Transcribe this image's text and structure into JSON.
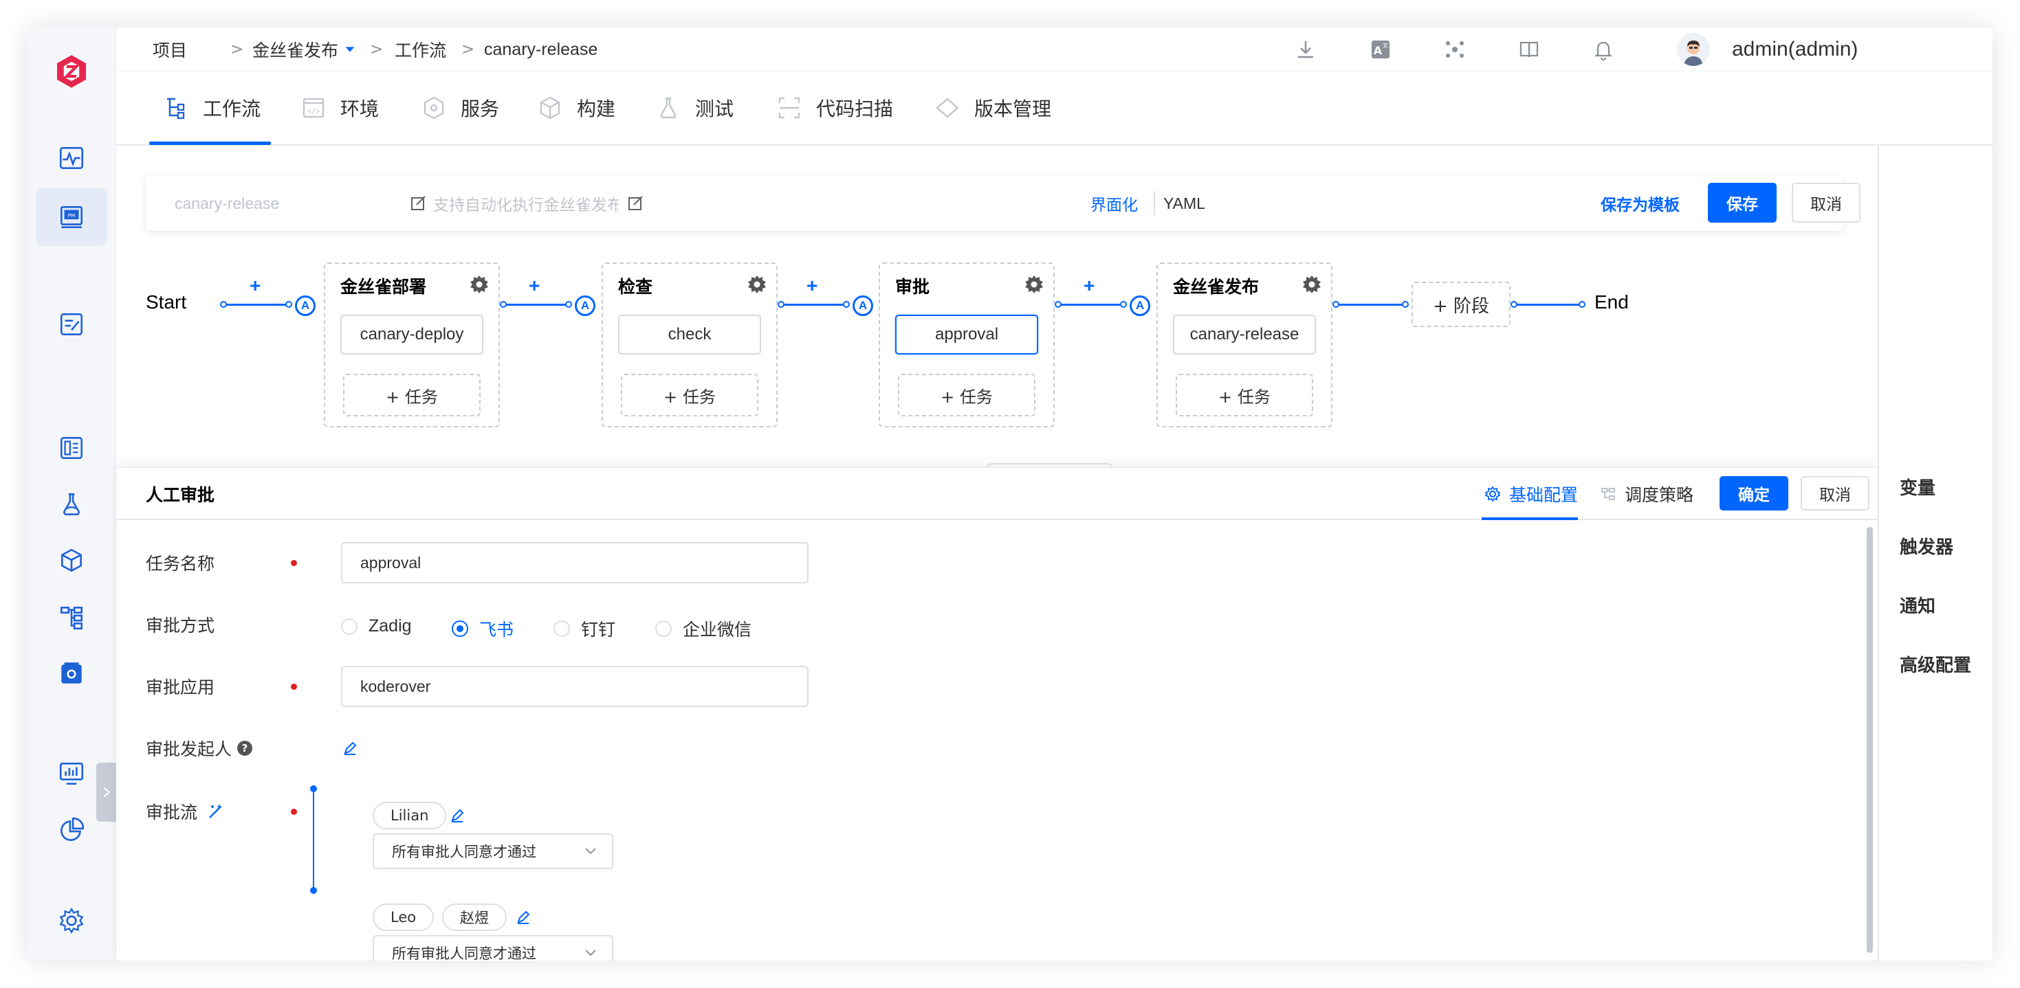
{
  "breadcrumb": {
    "items": [
      "项目",
      "金丝雀发布",
      "工作流",
      "canary-release"
    ],
    "separator": ">"
  },
  "user": {
    "name": "admin(admin)"
  },
  "tabs": [
    {
      "label": "工作流",
      "icon": "workflow-icon"
    },
    {
      "label": "环境",
      "icon": "environment-icon"
    },
    {
      "label": "服务",
      "icon": "service-icon"
    },
    {
      "label": "构建",
      "icon": "build-icon"
    },
    {
      "label": "测试",
      "icon": "test-icon"
    },
    {
      "label": "代码扫描",
      "icon": "scan-icon"
    },
    {
      "label": "版本管理",
      "icon": "version-icon"
    }
  ],
  "editor": {
    "name_placeholder": "canary-release",
    "desc_placeholder": "支持自动化执行金丝雀发布",
    "view_ui": "界面化",
    "view_yaml": "YAML",
    "save_as_template": "保存为模板",
    "save": "保存",
    "cancel": "取消"
  },
  "flow": {
    "start": "Start",
    "end": "End",
    "plus": "+",
    "approval_badge": "A",
    "add_task": "+ 任务",
    "add_stage": "+ 阶段",
    "stages": [
      {
        "title": "金丝雀部署",
        "task": "canary-deploy"
      },
      {
        "title": "检查",
        "task": "check"
      },
      {
        "title": "审批",
        "task": "approval"
      },
      {
        "title": "金丝雀发布",
        "task": "canary-release"
      }
    ]
  },
  "detail": {
    "title": "人工审批",
    "tab_basic": "基础配置",
    "tab_schedule": "调度策略",
    "confirm": "确定",
    "cancel": "取消",
    "fields": {
      "task_name_label": "任务名称",
      "task_name_value": "approval",
      "approve_type_label": "审批方式",
      "approve_options": [
        "Zadig",
        "飞书",
        "钉钉",
        "企业微信"
      ],
      "approve_selected": "飞书",
      "app_label": "审批应用",
      "app_value": "koderover",
      "initiator_label": "审批发起人",
      "flow_label": "审批流"
    },
    "approval_nodes": [
      {
        "approvers": [
          "Lilian"
        ],
        "policy": "所有审批人同意才通过"
      },
      {
        "approvers": [
          "Leo",
          "赵煜"
        ],
        "policy": "所有审批人同意才通过"
      }
    ]
  },
  "right_panel": [
    "变量",
    "触发器",
    "通知",
    "高级配置"
  ],
  "colors": {
    "accent": "#0066ff",
    "brand": "#e6264e",
    "required": "#e02020"
  }
}
